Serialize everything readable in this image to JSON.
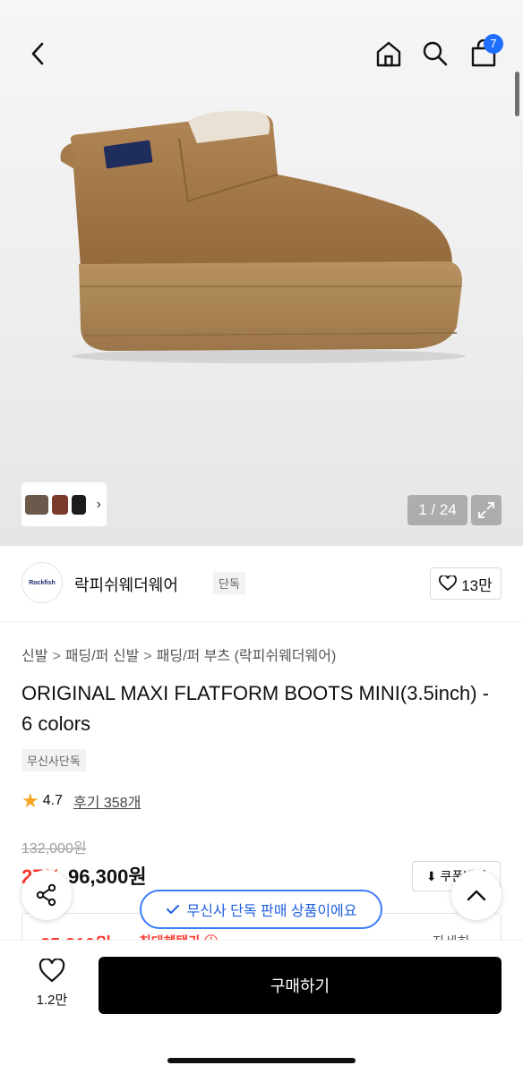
{
  "header": {
    "cart_count": "7",
    "icons": [
      "back-icon",
      "home-icon",
      "search-icon",
      "cart-icon"
    ]
  },
  "gallery": {
    "counter": "1 / 24",
    "thumb_chevron": "›"
  },
  "brand": {
    "logo_text": "Rockfish",
    "name": "락피쉬웨더웨어",
    "tag": "단독",
    "like_count": "13만"
  },
  "breadcrumb": {
    "items": [
      "신발",
      "패딩/퍼 신발",
      "패딩/퍼 부츠 (락피쉬웨더웨어)"
    ],
    "separator": ">"
  },
  "product": {
    "title": "ORIGINAL MAXI FLATFORM BOOTS MINI(3.5inch) - 6 colors",
    "exclusive_badge": "무신사단독",
    "rating": "4.7",
    "review_label": "후기 358개",
    "original_price": "132,000원",
    "discount": "27%",
    "price": "96,300원",
    "coupon_label": "⬇ 쿠폰받기"
  },
  "benefit": {
    "price": "85,810원",
    "label": "최대혜택가 ⓘ",
    "detail": "자세히 ⌄"
  },
  "toast": {
    "text": "무신사 단독 판매 상품이에요"
  },
  "bottom": {
    "wish_count": "1.2만",
    "buy_label": "구매하기"
  },
  "colors": {
    "accent_blue": "#1e6fff",
    "sale_red": "#ff3b30",
    "boot_tan": "#a07a4e"
  }
}
